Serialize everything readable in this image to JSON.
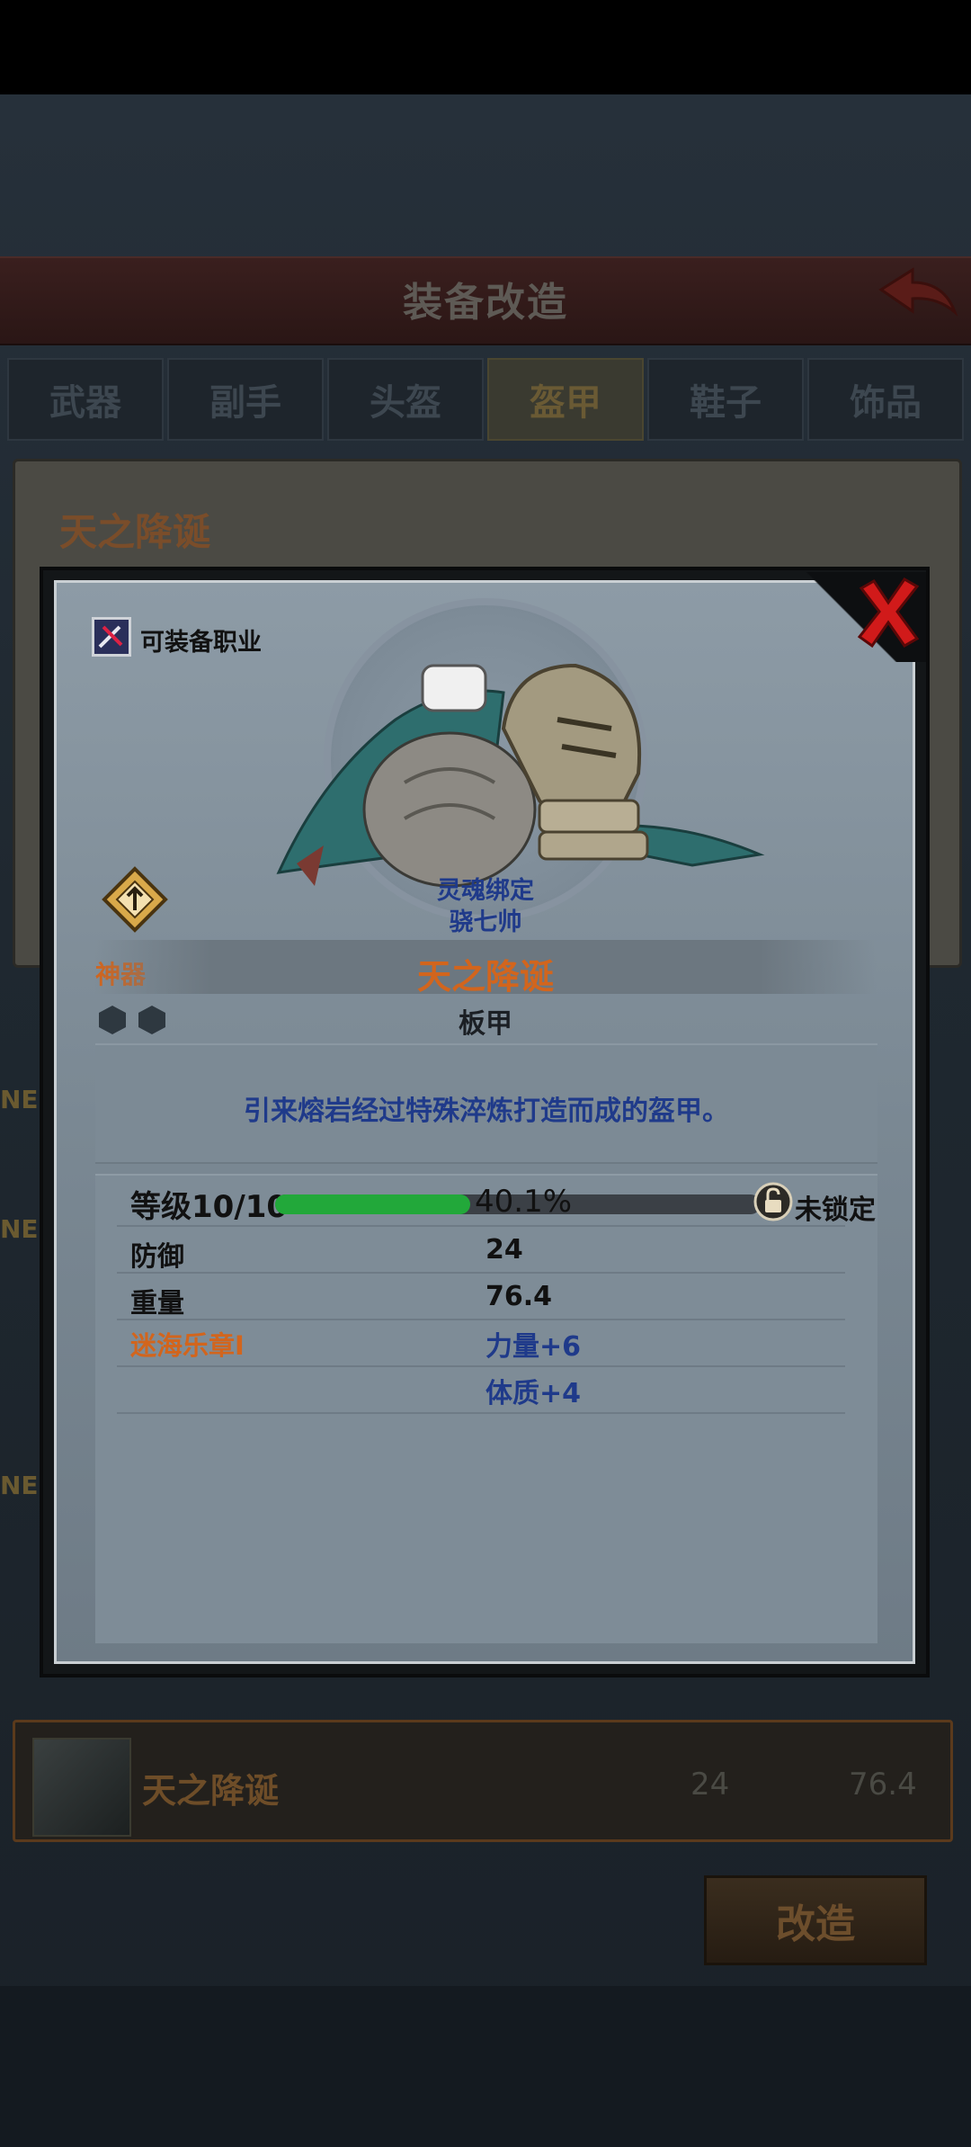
{
  "background": {
    "header_title": "装备改造",
    "tabs": [
      {
        "label": "武器",
        "active": false
      },
      {
        "label": "副手",
        "active": false
      },
      {
        "label": "头盔",
        "active": false
      },
      {
        "label": "盔甲",
        "active": true
      },
      {
        "label": "鞋子",
        "active": false
      },
      {
        "label": "饰品",
        "active": false
      }
    ],
    "detail_title": "天之降诞",
    "new_badge": "NE",
    "equipped_row": {
      "name": "天之降诞",
      "defense": "24",
      "weight": "76.4"
    },
    "modify_button": "改造"
  },
  "modal": {
    "class_label": "可装备职业",
    "soulbound": "灵魂绑定",
    "owner": "骁七帅",
    "rarity": "神器",
    "item_name": "天之降诞",
    "item_type": "板甲",
    "description": "引来熔岩经过特殊淬炼打造而成的盔甲。",
    "level_label": "等级10/10",
    "xp_fraction": 0.401,
    "xp_text": "40.1%",
    "lock_label": "未锁定",
    "stats": [
      {
        "label": "防御",
        "value": "24"
      },
      {
        "label": "重量",
        "value": "76.4"
      }
    ],
    "set_name": "迷海乐章I",
    "set_bonuses": [
      "力量+6",
      "体质+4"
    ]
  },
  "colors": {
    "rarity_orange": "#d2651d",
    "bonus_blue": "#1f3a8a",
    "xp_green": "#22a83a"
  },
  "icons": [
    "back-arrow-icon",
    "close-icon",
    "class-icon",
    "rarity-artifact-icon",
    "gem-socket-icon",
    "lock-icon"
  ]
}
